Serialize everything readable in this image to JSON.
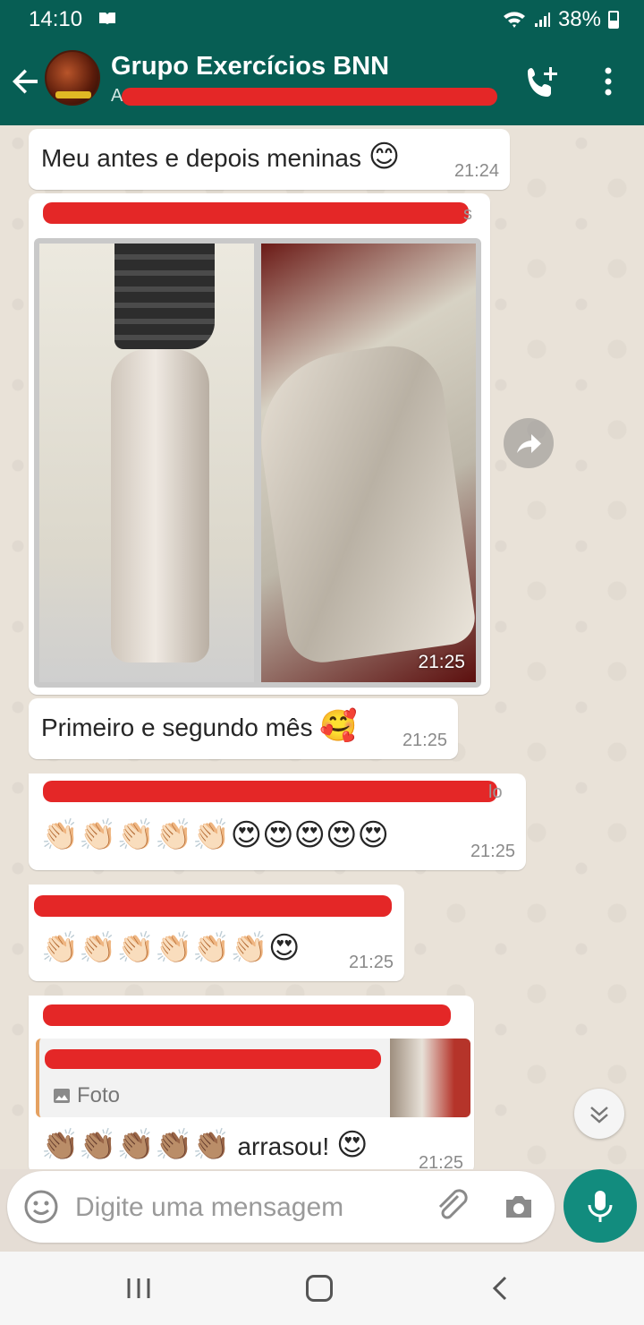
{
  "status_bar": {
    "time": "14:10",
    "battery": "38%"
  },
  "header": {
    "title": "Grupo Exercícios BNN",
    "subtitle_lead": "A"
  },
  "messages": [
    {
      "text": "Meu antes e depois meninas",
      "emoji": "😊",
      "time": "21:24"
    },
    {
      "sender_suffix": "s",
      "image_time": "21:25"
    },
    {
      "text": "Primeiro e segundo mês",
      "emoji": "🥰",
      "time": "21:25"
    },
    {
      "sender_suffix": "lo",
      "emojis": "👏🏻👏🏻👏🏻👏🏻👏🏻😍😍😍😍😍",
      "time": "21:25"
    },
    {
      "emojis": "👏🏻👏🏻👏🏻👏🏻👏🏻👏🏻😍",
      "time": "21:25"
    },
    {
      "quote_label": "Foto",
      "emojis": "👏🏽👏🏽👏🏽👏🏽👏🏽",
      "text": "arrasou!",
      "emoji": "😍",
      "time": "21:25"
    }
  ],
  "input": {
    "placeholder": "Digite uma mensagem"
  },
  "icons": {
    "back": "arrow-left-icon",
    "call": "add-call-icon",
    "menu": "more-vert-icon",
    "forward": "forward-icon",
    "scroll_down": "chevron-double-down-icon",
    "emoji": "smiley-icon",
    "attach": "paperclip-icon",
    "camera": "camera-icon",
    "mic": "mic-icon"
  },
  "colors": {
    "header": "#075e54",
    "mic_button": "#128c7e",
    "redaction": "#e42727",
    "quote_bar": "#e5a161"
  }
}
